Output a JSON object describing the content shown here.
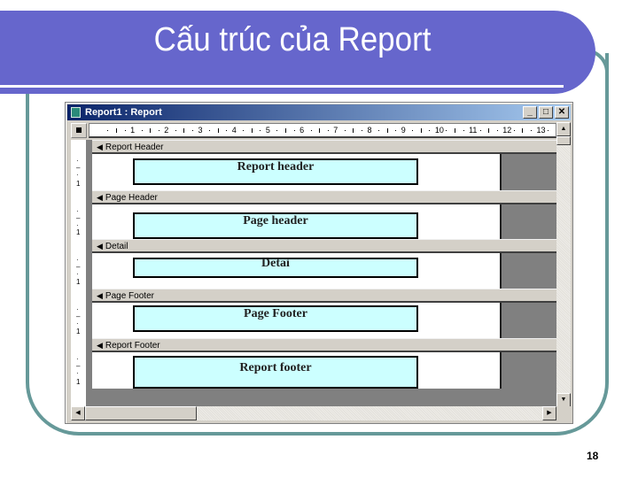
{
  "slide": {
    "title": "Cấu trúc của Report",
    "page_number": "18",
    "colors": {
      "banner": "#6666cc",
      "frame": "#669999",
      "control_fill": "#ccffff"
    }
  },
  "window": {
    "title": "Report1 : Report",
    "icon": "report-icon",
    "buttons": {
      "minimize": "_",
      "maximize": "□",
      "close": "✕"
    }
  },
  "ruler": {
    "numbers": [
      "1",
      "2",
      "3",
      "4",
      "5",
      "6",
      "7",
      "8",
      "9",
      "10",
      "11",
      "12",
      "13"
    ]
  },
  "sections": [
    {
      "band_label": "Report Header",
      "control_text": "Report header"
    },
    {
      "band_label": "Page Header",
      "control_text": "Page header"
    },
    {
      "band_label": "Detail",
      "control_text": "Detai"
    },
    {
      "band_label": "Page Footer",
      "control_text": "Page Footer"
    },
    {
      "band_label": "Report Footer",
      "control_text": "Report footer"
    }
  ],
  "vruler_mark": "1",
  "scroll": {
    "up": "▲",
    "down": "▼",
    "left": "◀",
    "right": "▶"
  }
}
